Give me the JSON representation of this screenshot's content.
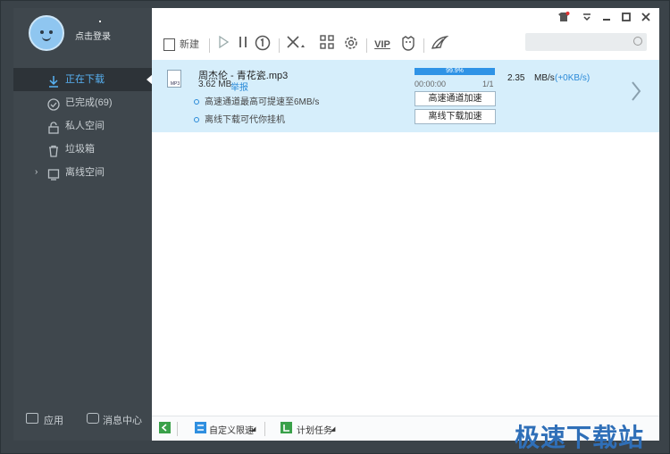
{
  "sidebar": {
    "login_label": "点击登录",
    "items": [
      {
        "label": "正在下载"
      },
      {
        "label": "已完成(69)"
      },
      {
        "label": "私人空间"
      },
      {
        "label": "垃圾箱"
      },
      {
        "label": "离线空间"
      }
    ],
    "footer": {
      "apps_label": "应用",
      "messages_label": "消息中心"
    }
  },
  "toolbar": {
    "new_label": "新建",
    "vip_label": "VIP"
  },
  "download": {
    "file_name": "周杰伦 - 青花瓷.mp3",
    "file_ext": "MP3",
    "size": "3.62 MB",
    "report_label": "举报",
    "hint_1": "高速通道最高可提速至6MB/s",
    "hint_2": "离线下载可代你挂机",
    "progress_text": "99.9%",
    "progress_value": 0.999,
    "time_left": "00:00:00",
    "count": "1/1",
    "speed_value": "2.35",
    "speed_unit": "MB/s",
    "speed_boost": "(+0KB/s)",
    "btn_highspeed": "高速通道加速",
    "btn_offline": "离线下载加速"
  },
  "bottom": {
    "custom_limit": "自定义限速",
    "scheduled": "计划任务"
  },
  "watermark": "极速下载站"
}
